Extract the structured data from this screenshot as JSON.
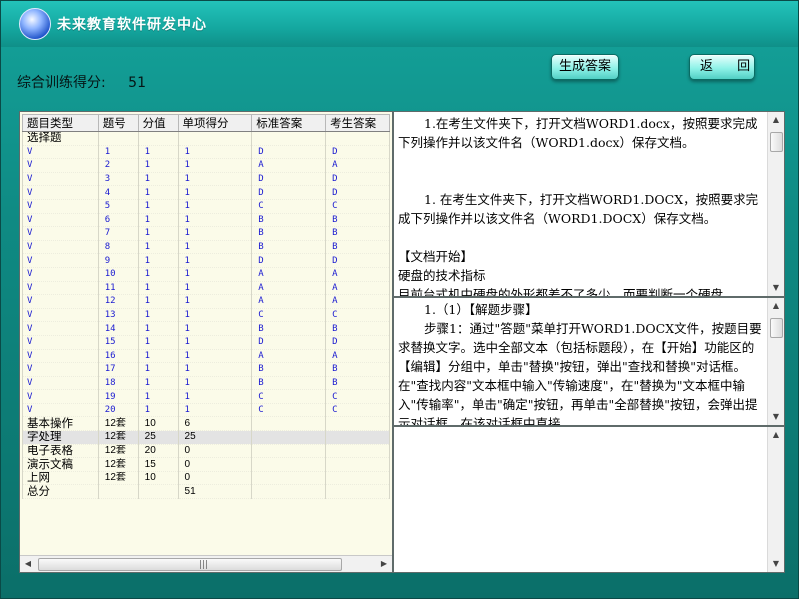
{
  "titlebar": {
    "title": "未来教育软件研发中心",
    "logo_icon": "globe-logo-icon"
  },
  "score": {
    "label": "综合训练得分:",
    "value": "51"
  },
  "buttons": {
    "generate": "生成答案",
    "back": "返 回"
  },
  "table": {
    "headers": [
      "题目类型",
      "题号",
      "分值",
      "单项得分",
      "标准答案",
      "考生答案"
    ],
    "section_label": "选择题",
    "choice_rows": [
      [
        "V",
        "1",
        "1",
        "1",
        "D",
        "D"
      ],
      [
        "V",
        "2",
        "1",
        "1",
        "A",
        "A"
      ],
      [
        "V",
        "3",
        "1",
        "1",
        "D",
        "D"
      ],
      [
        "V",
        "4",
        "1",
        "1",
        "D",
        "D"
      ],
      [
        "V",
        "5",
        "1",
        "1",
        "C",
        "C"
      ],
      [
        "V",
        "6",
        "1",
        "1",
        "B",
        "B"
      ],
      [
        "V",
        "7",
        "1",
        "1",
        "B",
        "B"
      ],
      [
        "V",
        "8",
        "1",
        "1",
        "B",
        "B"
      ],
      [
        "V",
        "9",
        "1",
        "1",
        "D",
        "D"
      ],
      [
        "V",
        "10",
        "1",
        "1",
        "A",
        "A"
      ],
      [
        "V",
        "11",
        "1",
        "1",
        "A",
        "A"
      ],
      [
        "V",
        "12",
        "1",
        "1",
        "A",
        "A"
      ],
      [
        "V",
        "13",
        "1",
        "1",
        "C",
        "C"
      ],
      [
        "V",
        "14",
        "1",
        "1",
        "B",
        "B"
      ],
      [
        "V",
        "15",
        "1",
        "1",
        "D",
        "D"
      ],
      [
        "V",
        "16",
        "1",
        "1",
        "A",
        "A"
      ],
      [
        "V",
        "17",
        "1",
        "1",
        "B",
        "B"
      ],
      [
        "V",
        "18",
        "1",
        "1",
        "B",
        "B"
      ],
      [
        "V",
        "19",
        "1",
        "1",
        "C",
        "C"
      ],
      [
        "V",
        "20",
        "1",
        "1",
        "C",
        "C"
      ]
    ],
    "summary_rows": [
      [
        "基本操作",
        "12套",
        "10",
        "6",
        "",
        ""
      ],
      [
        "字处理",
        "12套",
        "25",
        "25",
        "",
        ""
      ],
      [
        "电子表格",
        "12套",
        "20",
        "0",
        "",
        ""
      ],
      [
        "演示文稿",
        "12套",
        "15",
        "0",
        "",
        ""
      ],
      [
        "上网",
        "12套",
        "10",
        "0",
        "",
        ""
      ],
      [
        "总分",
        "",
        "",
        "51",
        "",
        ""
      ]
    ],
    "selected_summary_row": 1
  },
  "question_panel": {
    "para1": "1.在考生文件夹下，打开文档WORD1.docx，按照要求完成下列操作并以该文件名（WORD1.docx）保存文档。",
    "para2": "1. 在考生文件夹下，打开文档WORD1.DOCX，按照要求完成下列操作并以该文件名（WORD1.DOCX）保存文档。",
    "para3": "【文档开始】",
    "para4": "硬盘的技术指标",
    "para5": "目前台式机中硬盘的外形都差不了多少，而要判断一个硬盘"
  },
  "steps_panel": {
    "para1": "1.（1）【解题步骤】",
    "para2": "步骤1：通过\"答题\"菜单打开WORD1.DOCX文件，按题目要求替换文字。选中全部文本（包括标题段），在【开始】功能区的【编辑】分组中，单击\"替换\"按钮，弹出\"查找和替换\"对话框。在\"查找内容\"文本框中输入\"传输速度\"，在\"替换为\"文本框中输入\"传输率\"，单击\"确定\"按钮，再单击\"全部替换\"按钮，会弹出提示对话框，在该对话框中直接"
  },
  "colors": {
    "background": "#0f8b84",
    "titlebar": "#23c3ba",
    "table_bg": "#fbfbe9",
    "cell_text": "#1b1bd1"
  }
}
